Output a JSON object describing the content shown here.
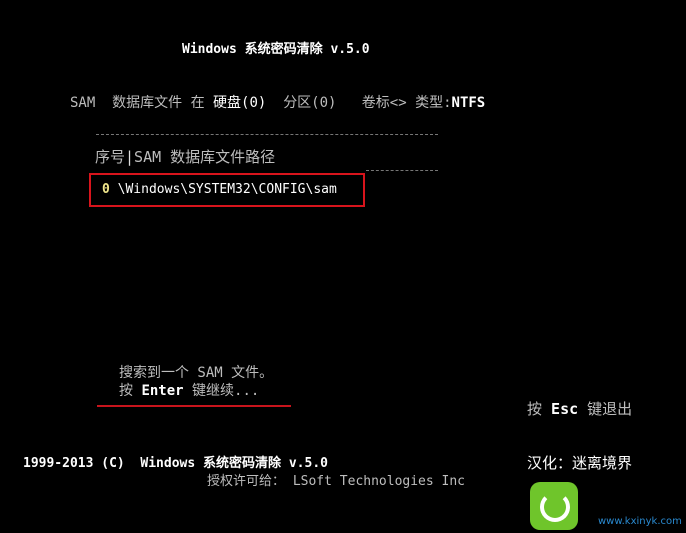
{
  "title": "Windows 系统密码清除 v.5.0",
  "info": {
    "sam": "SAM",
    "db_file_at": "数据库文件 在",
    "disk": "硬盘(0)",
    "partition": "分区(0)",
    "label": "卷标<>",
    "type_label": "类型:",
    "type_value": "NTFS"
  },
  "table": {
    "col_index": "序号",
    "col_path": "SAM 数据库文件路径",
    "rows": [
      {
        "index": "0",
        "path": "\\Windows\\SYSTEM32\\CONFIG\\sam"
      }
    ]
  },
  "status": {
    "found": "搜索到一个 SAM 文件。",
    "press": "按",
    "enter": "Enter",
    "continue": "键继续..."
  },
  "esc": {
    "press": "按",
    "key": "Esc",
    "exit": "键退出"
  },
  "footer": {
    "copyright": "1999-2013 (C)  Windows 系统密码清除 v.5.0",
    "license": "授权许可给： LSoft Technologies Inc",
    "translator": "汉化：迷离境界"
  },
  "watermark": {
    "url": "www.kxinyk.com"
  },
  "colors": {
    "highlight": "#d8141c",
    "index": "#f0e68c",
    "watermark": "#6fc52b"
  }
}
